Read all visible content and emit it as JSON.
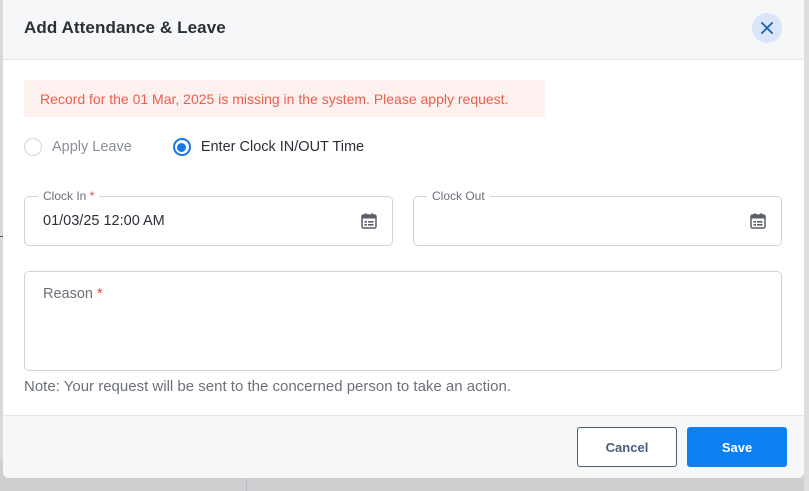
{
  "modal": {
    "title": "Add Attendance & Leave",
    "close_icon": "close-icon"
  },
  "alert": {
    "message": "Record for the 01 Mar, 2025 is missing in the system. Please apply request.",
    "color": "#ea5e4e"
  },
  "request_type": {
    "options": [
      {
        "label": "Apply Leave",
        "selected": false
      },
      {
        "label": "Enter Clock IN/OUT Time",
        "selected": true
      }
    ]
  },
  "clock_in": {
    "label": "Clock In",
    "required_mark": "*",
    "value": "01/03/25 12:00 AM",
    "icon": "calendar-icon"
  },
  "clock_out": {
    "label": "Clock Out",
    "value": "",
    "icon": "calendar-icon"
  },
  "reason": {
    "label": "Reason",
    "required_mark": "*",
    "value": ""
  },
  "note": "Note: Your request will be sent to the concerned person to take an action.",
  "footer": {
    "cancel_label": "Cancel",
    "save_label": "Save"
  },
  "colors": {
    "accent": "#0c7ff2",
    "alert_bg": "#fdf1ef",
    "required": "#e5473a"
  }
}
